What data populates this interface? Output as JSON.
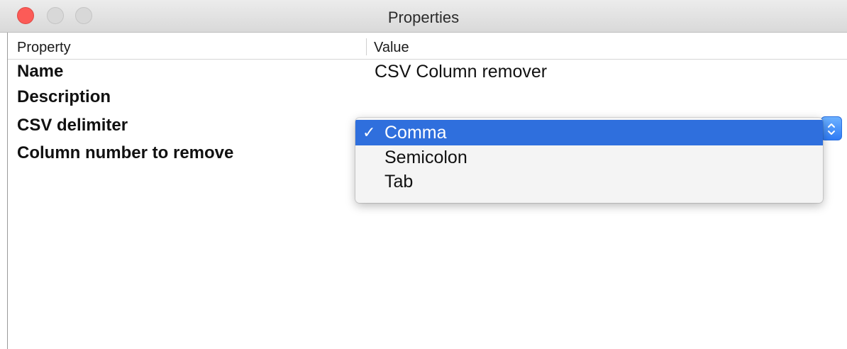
{
  "window": {
    "title": "Properties"
  },
  "table": {
    "columns": {
      "property": "Property",
      "value": "Value"
    },
    "rows": [
      {
        "label": "Name",
        "value": "CSV Column remover"
      },
      {
        "label": "Description",
        "value": ""
      },
      {
        "label": "CSV delimiter",
        "value": ""
      },
      {
        "label": "Column number to remove",
        "value": ""
      }
    ]
  },
  "dropdown": {
    "check_mark": "✓",
    "options": [
      {
        "label": "Comma",
        "selected": true
      },
      {
        "label": "Semicolon",
        "selected": false
      },
      {
        "label": "Tab",
        "selected": false
      }
    ]
  },
  "icons": {
    "select_stepper": "chevron-up-down-icon"
  },
  "colors": {
    "close_button": "#fc5b57",
    "selection": "#2f6fdd",
    "select_button": "#2f7bf5"
  }
}
